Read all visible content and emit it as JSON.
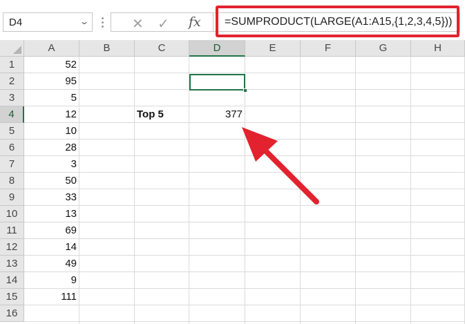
{
  "name_box": {
    "value": "D4"
  },
  "formula_bar": {
    "formula": "=SUMPRODUCT(LARGE(A1:A15,{1,2,3,4,5}))"
  },
  "icons": {
    "cancel": "✕",
    "enter": "✓",
    "fx": "fx",
    "dropdown": "⌄",
    "highlight_color": "#e2222e",
    "arrow_color": "#e2222e",
    "selection_color": "#217346"
  },
  "columns": [
    "A",
    "B",
    "C",
    "D",
    "E",
    "F",
    "G",
    "H"
  ],
  "rows": [
    "1",
    "2",
    "3",
    "4",
    "5",
    "6",
    "7",
    "8",
    "9",
    "10",
    "11",
    "12",
    "13",
    "14",
    "15",
    "16"
  ],
  "column_a_values": [
    "52",
    "95",
    "5",
    "12",
    "10",
    "28",
    "3",
    "50",
    "33",
    "13",
    "69",
    "14",
    "49",
    "9",
    "111"
  ],
  "label": {
    "text": "Top 5"
  },
  "result": {
    "value": "377"
  },
  "selected": {
    "column": "D",
    "row": "4"
  }
}
